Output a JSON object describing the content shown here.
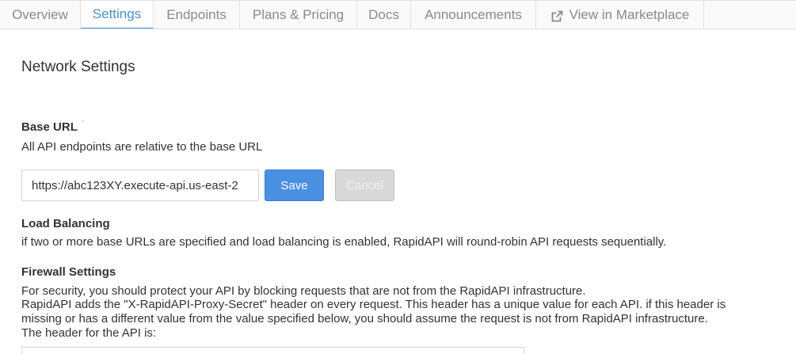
{
  "tabs": [
    {
      "label": "Overview"
    },
    {
      "label": "Settings"
    },
    {
      "label": "Endpoints"
    },
    {
      "label": "Plans & Pricing"
    },
    {
      "label": "Docs"
    },
    {
      "label": "Announcements"
    },
    {
      "label": "View in Marketplace",
      "icon": "external-link-icon"
    }
  ],
  "active_tab": "Settings",
  "colors": {
    "accent": "#4a90e2",
    "cancel_bg": "#d9d9d9",
    "text": "#333333",
    "tab_text": "#8a8a8a"
  },
  "page": {
    "title": "Network Settings"
  },
  "base_url": {
    "label": "Base URL",
    "required_marker": "*",
    "description": "All API endpoints are relative to the base URL",
    "value": "https://abc123XY.execute-api.us-east-2",
    "save_label": "Save",
    "cancel_label": "Cancel"
  },
  "load_balancing": {
    "label": "Load Balancing",
    "description": "if two or more base URLs are specified and load balancing is enabled, RapidAPI will round-robin API requests sequentially."
  },
  "firewall": {
    "label": "Firewall Settings",
    "line1": "For security, you should protect your API by blocking requests that are not from the RapidAPI infrastructure.",
    "line2": "RapidAPI adds the \"X-RapidAPI-Proxy-Secret\" header on every request. This header has a unique value for each API. if this header is",
    "line3": "missing or has a different value from the value specified below, you should assume the request is not from RapidAPI infrastructure.",
    "line4": "The header for the API is:"
  }
}
